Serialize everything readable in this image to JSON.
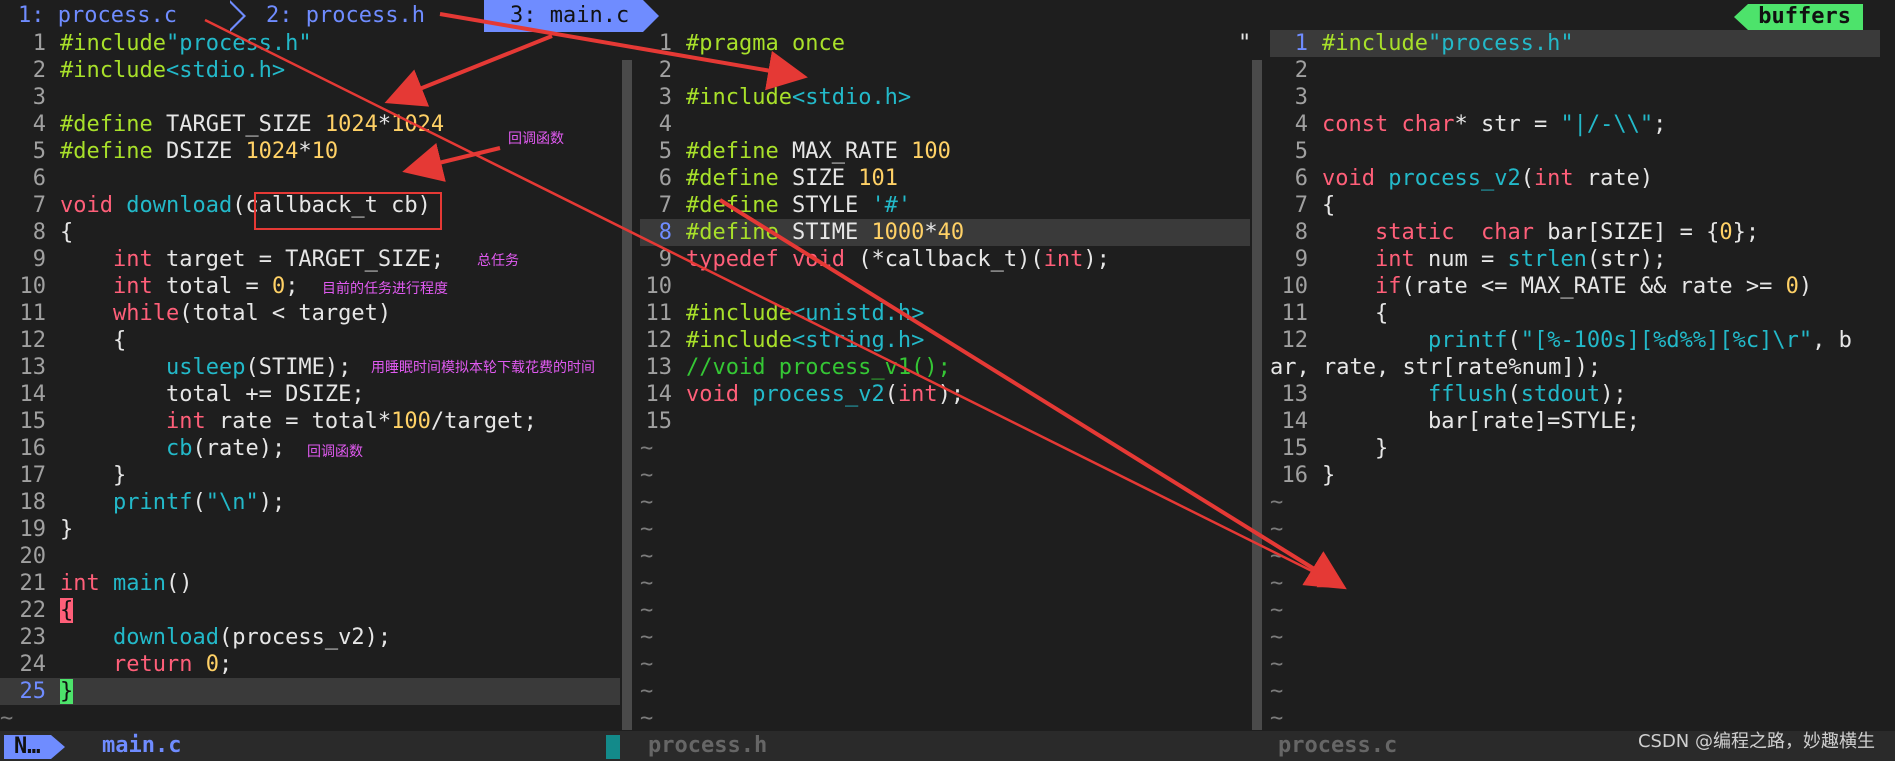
{
  "tabline": {
    "tabs": [
      {
        "label": "1: process.c"
      },
      {
        "label": "2: process.h"
      },
      {
        "label": "3: main.c"
      }
    ],
    "buffers_label": "buffers"
  },
  "panes": {
    "left": {
      "filename": "main.c",
      "lines": [
        [
          {
            "t": "#include",
            "c": "pp"
          },
          {
            "t": "\"process.h\"",
            "c": "str"
          }
        ],
        [
          {
            "t": "#include",
            "c": "pp"
          },
          {
            "t": "<stdio.h>",
            "c": "str"
          }
        ],
        [],
        [
          {
            "t": "#define",
            "c": "pp"
          },
          {
            "t": " TARGET_SIZE "
          },
          {
            "t": "1024",
            "c": "num"
          },
          {
            "t": "*"
          },
          {
            "t": "1024",
            "c": "num"
          }
        ],
        [
          {
            "t": "#define",
            "c": "pp"
          },
          {
            "t": " DSIZE "
          },
          {
            "t": "1024",
            "c": "num"
          },
          {
            "t": "*"
          },
          {
            "t": "10",
            "c": "num"
          }
        ],
        [],
        [
          {
            "t": "void",
            "c": "ty"
          },
          {
            "t": " "
          },
          {
            "t": "download",
            "c": "fn"
          },
          {
            "t": "("
          },
          {
            "t": "callback_t cb"
          },
          {
            "t": ")"
          }
        ],
        [
          {
            "t": "{"
          }
        ],
        [
          {
            "t": "    "
          },
          {
            "t": "int",
            "c": "ty"
          },
          {
            "t": " target = TARGET_SIZE;"
          }
        ],
        [
          {
            "t": "    "
          },
          {
            "t": "int",
            "c": "ty"
          },
          {
            "t": " total = "
          },
          {
            "t": "0",
            "c": "num"
          },
          {
            "t": ";"
          }
        ],
        [
          {
            "t": "    "
          },
          {
            "t": "while",
            "c": "kw"
          },
          {
            "t": "(total < target)"
          }
        ],
        [
          {
            "t": "    {"
          }
        ],
        [
          {
            "t": "        "
          },
          {
            "t": "usleep",
            "c": "fn"
          },
          {
            "t": "(STIME);"
          }
        ],
        [
          {
            "t": "        total += DSIZE;"
          }
        ],
        [
          {
            "t": "        "
          },
          {
            "t": "int",
            "c": "ty"
          },
          {
            "t": " rate = total*"
          },
          {
            "t": "100",
            "c": "num"
          },
          {
            "t": "/target;"
          }
        ],
        [
          {
            "t": "        "
          },
          {
            "t": "cb",
            "c": "fn"
          },
          {
            "t": "(rate);"
          }
        ],
        [
          {
            "t": "    }"
          }
        ],
        [
          {
            "t": "    "
          },
          {
            "t": "printf",
            "c": "fn"
          },
          {
            "t": "("
          },
          {
            "t": "\"\\n\"",
            "c": "str"
          },
          {
            "t": ");"
          }
        ],
        [
          {
            "t": "}"
          }
        ],
        [],
        [
          {
            "t": "int",
            "c": "ty"
          },
          {
            "t": " "
          },
          {
            "t": "main",
            "c": "fn"
          },
          {
            "t": "()"
          }
        ],
        [
          {
            "t": "{",
            "c": "brace1"
          }
        ],
        [
          {
            "t": "    "
          },
          {
            "t": "download",
            "c": "fn"
          },
          {
            "t": "(process_v2);"
          }
        ],
        [
          {
            "t": "    "
          },
          {
            "t": "return",
            "c": "kw"
          },
          {
            "t": " "
          },
          {
            "t": "0",
            "c": "num"
          },
          {
            "t": ";"
          }
        ],
        [
          {
            "t": "}",
            "c": "brace2"
          }
        ]
      ],
      "current_line": 25,
      "tilde_count": 1
    },
    "middle": {
      "filename": "process.h",
      "lines": [
        [
          {
            "t": "#pragma once",
            "c": "pp"
          }
        ],
        [],
        [
          {
            "t": "#include",
            "c": "pp"
          },
          {
            "t": "<stdio.h>",
            "c": "str"
          }
        ],
        [],
        [
          {
            "t": "#define",
            "c": "pp"
          },
          {
            "t": " MAX_RATE "
          },
          {
            "t": "100",
            "c": "num"
          }
        ],
        [
          {
            "t": "#define",
            "c": "pp"
          },
          {
            "t": " SIZE "
          },
          {
            "t": "101",
            "c": "num"
          }
        ],
        [
          {
            "t": "#define",
            "c": "pp"
          },
          {
            "t": " STYLE "
          },
          {
            "t": "'#'",
            "c": "str"
          }
        ],
        [
          {
            "t": "#define",
            "c": "pp"
          },
          {
            "t": " STIME "
          },
          {
            "t": "1000",
            "c": "num"
          },
          {
            "t": "*"
          },
          {
            "t": "40",
            "c": "num"
          }
        ],
        [
          {
            "t": "typedef",
            "c": "kw"
          },
          {
            "t": " "
          },
          {
            "t": "void",
            "c": "ty"
          },
          {
            "t": " (*callback_t)("
          },
          {
            "t": "int",
            "c": "ty"
          },
          {
            "t": ");"
          }
        ],
        [],
        [
          {
            "t": "#include",
            "c": "pp"
          },
          {
            "t": "<unistd.h>",
            "c": "str"
          }
        ],
        [
          {
            "t": "#include",
            "c": "pp"
          },
          {
            "t": "<string.h>",
            "c": "str"
          }
        ],
        [
          {
            "t": "//void process_v1();",
            "c": "cm"
          }
        ],
        [
          {
            "t": "void",
            "c": "ty"
          },
          {
            "t": " "
          },
          {
            "t": "process_v2",
            "c": "fn"
          },
          {
            "t": "("
          },
          {
            "t": "int",
            "c": "ty"
          },
          {
            "t": ");"
          }
        ],
        []
      ],
      "current_line": 8,
      "tilde_count": 11
    },
    "right": {
      "filename": "process.c",
      "lines": [
        [
          {
            "t": "#include",
            "c": "pp"
          },
          {
            "t": "\"process.h\"",
            "c": "str"
          }
        ],
        [],
        [],
        [
          {
            "t": "const",
            "c": "kw"
          },
          {
            "t": " "
          },
          {
            "t": "char",
            "c": "ty"
          },
          {
            "t": "* str = "
          },
          {
            "t": "\"|/-\\\\\"",
            "c": "str"
          },
          {
            "t": ";"
          }
        ],
        [],
        [
          {
            "t": "void",
            "c": "ty"
          },
          {
            "t": " "
          },
          {
            "t": "process_v2",
            "c": "fn"
          },
          {
            "t": "("
          },
          {
            "t": "int",
            "c": "ty"
          },
          {
            "t": " rate)"
          }
        ],
        [
          {
            "t": "{"
          }
        ],
        [
          {
            "t": "    "
          },
          {
            "t": "static",
            "c": "kw"
          },
          {
            "t": "  "
          },
          {
            "t": "char",
            "c": "ty"
          },
          {
            "t": " bar[SIZE] = {"
          },
          {
            "t": "0",
            "c": "num"
          },
          {
            "t": "};"
          }
        ],
        [
          {
            "t": "    "
          },
          {
            "t": "int",
            "c": "ty"
          },
          {
            "t": " num = "
          },
          {
            "t": "strlen",
            "c": "fn"
          },
          {
            "t": "(str);"
          }
        ],
        [
          {
            "t": "    "
          },
          {
            "t": "if",
            "c": "kw"
          },
          {
            "t": "(rate <= MAX_RATE && rate >= "
          },
          {
            "t": "0",
            "c": "num"
          },
          {
            "t": ")"
          }
        ],
        [
          {
            "t": "    {"
          }
        ],
        [
          {
            "t": "        "
          },
          {
            "t": "printf",
            "c": "fn"
          },
          {
            "t": "("
          },
          {
            "t": "\"[%-100s][%d%%][%c]\\r\"",
            "c": "str"
          },
          {
            "t": ", b"
          }
        ],
        [
          {
            "t": "        "
          },
          {
            "t": "fflush",
            "c": "fn"
          },
          {
            "t": "("
          },
          {
            "t": "stdout",
            "c": "fn"
          },
          {
            "t": ");"
          }
        ],
        [
          {
            "t": "        bar[rate]=STYLE;"
          }
        ],
        [
          {
            "t": "    }"
          }
        ],
        [
          {
            "t": "}"
          }
        ]
      ],
      "wrapped_continuation": "ar, rate, str[rate%num]);",
      "current_line": 1,
      "tilde_count": 9
    }
  },
  "statusline": {
    "mode": "N…"
  },
  "annotations": {
    "callback_func_1": "回调函数",
    "total_task": "总任务",
    "current_progress": "目前的任务进行程度",
    "sleep_simulate": "用睡眠时间模拟本轮下载花费的时间",
    "callback_func_2": "回调函数"
  },
  "watermark": "CSDN @编程之路，妙趣横生",
  "colors": {
    "accent": "#6f8cff",
    "buffers_bg": "#4de36b",
    "annotation": "#e05af0",
    "arrow": "#e53935"
  }
}
